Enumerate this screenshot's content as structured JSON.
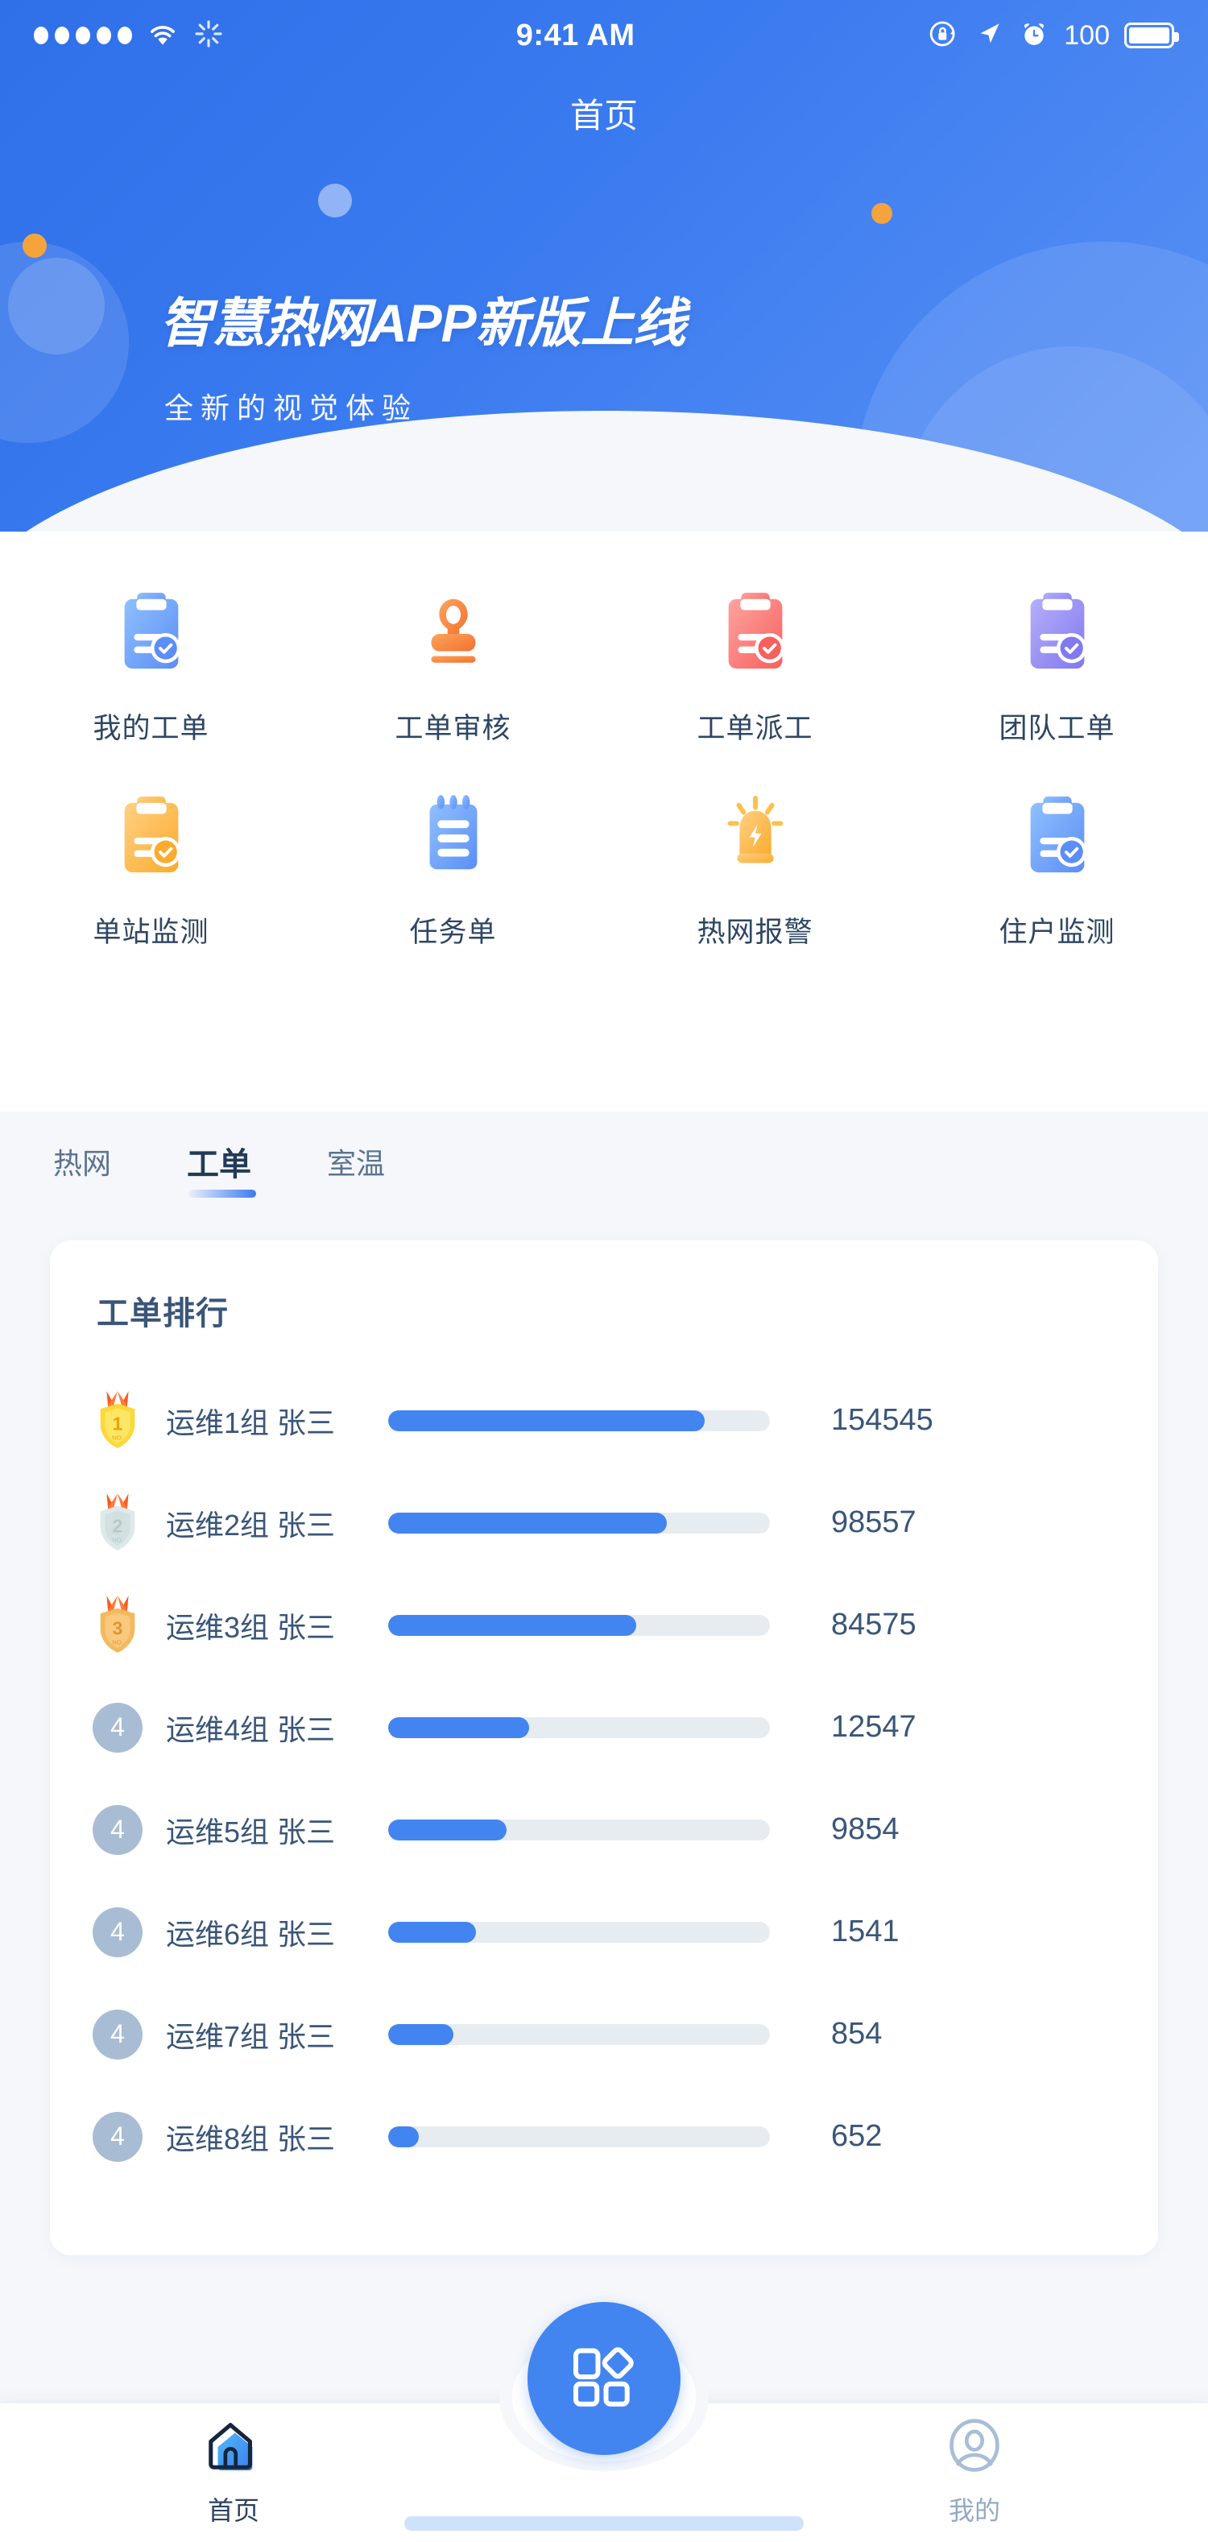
{
  "status_bar": {
    "signal_dots": 5,
    "wifi_icon": "wifi-icon",
    "sync_icon": "loading-spinner-icon",
    "time": "9:41 AM",
    "rotation_lock_icon": "rotation-lock-icon",
    "location_icon": "location-arrow-icon",
    "alarm_icon": "alarm-clock-icon",
    "battery_percent": "100",
    "battery_icon": "battery-full-icon"
  },
  "nav": {
    "title": "首页"
  },
  "banner": {
    "title": "智慧热网APP新版上线",
    "subtitle": "全新的视觉体验",
    "bg_color": "#3b7bf0",
    "accent_dot_color": "#f5a33c"
  },
  "shortcuts": [
    {
      "label": "我的工单",
      "icon": "clipboard-check-icon",
      "color": "#6fa6fa"
    },
    {
      "label": "工单审核",
      "icon": "stamp-icon",
      "color": "#f7893f"
    },
    {
      "label": "工单派工",
      "icon": "clipboard-check-icon",
      "color": "#fb7b76"
    },
    {
      "label": "团队工单",
      "icon": "clipboard-check-icon",
      "color": "#9b93f2"
    },
    {
      "label": "单站监测",
      "icon": "clipboard-check-icon",
      "color": "#fcb441"
    },
    {
      "label": "任务单",
      "icon": "notepad-icon",
      "color": "#6fa6fa"
    },
    {
      "label": "热网报警",
      "icon": "alarm-siren-icon",
      "color": "#fcb441"
    },
    {
      "label": "住户监测",
      "icon": "clipboard-check-icon",
      "color": "#6fa6fa"
    }
  ],
  "tabs": [
    {
      "label": "热网",
      "active": false
    },
    {
      "label": "工单",
      "active": true
    },
    {
      "label": "室温",
      "active": false
    }
  ],
  "rank_card": {
    "title": "工单排行",
    "bar_track_color": "#e7ecf1",
    "bar_fill_color": "#4285f0"
  },
  "chart_data": {
    "type": "bar",
    "title": "工单排行",
    "orientation": "horizontal",
    "xlabel": "",
    "ylabel": "",
    "grid": false,
    "legend": "none",
    "categories": [
      "运维1组  张三",
      "运维2组  张三",
      "运维3组  张三",
      "运维4组  张三",
      "运维5组  张三",
      "运维6组  张三",
      "运维7组  张三",
      "运维8组  张三"
    ],
    "values": [
      154545,
      98557,
      84575,
      12547,
      9854,
      1541,
      854,
      652
    ],
    "value_labels": [
      "154545",
      "98557",
      "84575",
      "12547",
      "9854",
      "1541",
      "854",
      "652"
    ],
    "bar_fill_percent": [
      83,
      73,
      65,
      37,
      31,
      23,
      17,
      8
    ],
    "rank_badges": [
      "gold-medal",
      "silver-medal",
      "bronze-medal",
      "4",
      "4",
      "4",
      "4",
      "4"
    ],
    "rank_numbers": [
      "1",
      "2",
      "3",
      "4",
      "4",
      "4",
      "4",
      "4"
    ],
    "medal_sub_label": "NO."
  },
  "tabbar": {
    "items": [
      {
        "label": "首页",
        "icon": "home-icon",
        "active": true
      },
      {
        "label": "我的",
        "icon": "user-profile-icon",
        "active": false
      }
    ],
    "fab_icon": "grid-apps-icon",
    "fab_color": "#4285f0"
  }
}
